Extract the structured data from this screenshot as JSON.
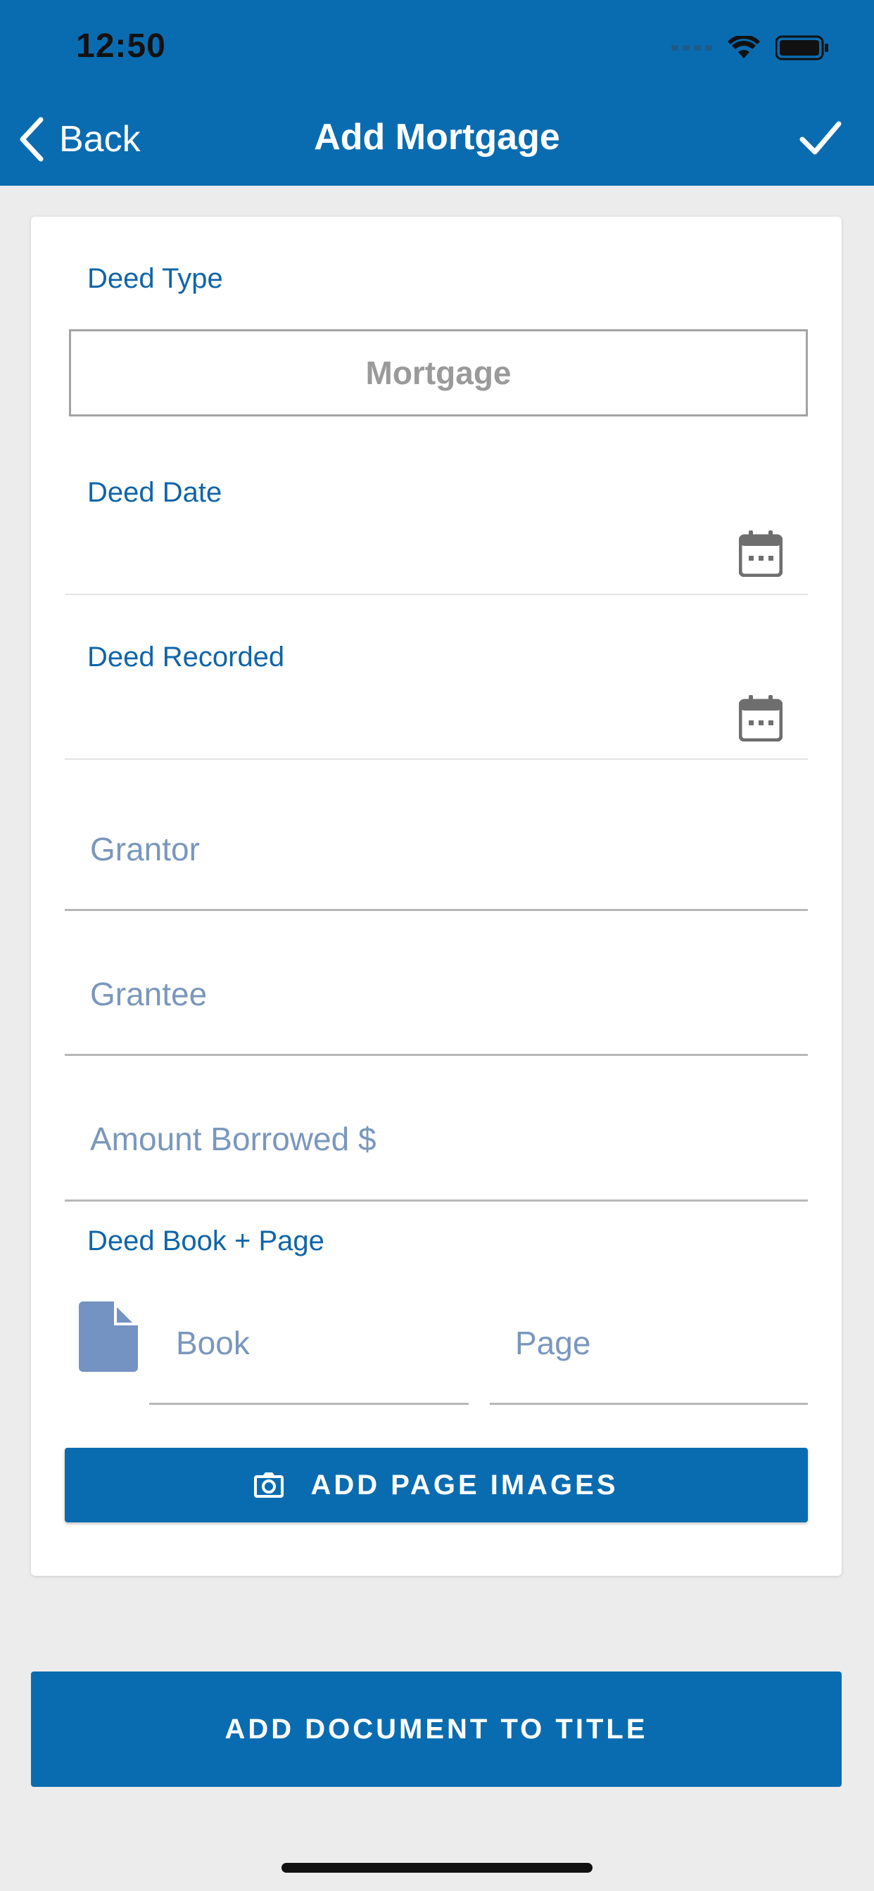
{
  "status_bar": {
    "time": "12:50",
    "icons": [
      "signal-icon",
      "wifi-icon",
      "battery-icon"
    ]
  },
  "nav": {
    "back_label": "Back",
    "title": "Add Mortgage",
    "done_icon": "checkmark-icon"
  },
  "form": {
    "deed_type": {
      "label": "Deed Type",
      "value": "Mortgage"
    },
    "deed_date": {
      "label": "Deed Date",
      "value": ""
    },
    "deed_recorded": {
      "label": "Deed Recorded",
      "value": ""
    },
    "grantor": {
      "placeholder": "Grantor",
      "value": ""
    },
    "grantee": {
      "placeholder": "Grantee",
      "value": ""
    },
    "amount_borrowed": {
      "placeholder": "Amount Borrowed $",
      "value": ""
    },
    "deed_book_page": {
      "label": "Deed Book + Page",
      "book_placeholder": "Book",
      "page_placeholder": "Page"
    },
    "add_page_images_label": "ADD PAGE IMAGES"
  },
  "add_document_label": "ADD DOCUMENT TO TITLE",
  "colors": {
    "primary": "#0a6cb0",
    "label": "#1065a8",
    "placeholder": "#7a97bd",
    "background": "#ececec"
  }
}
